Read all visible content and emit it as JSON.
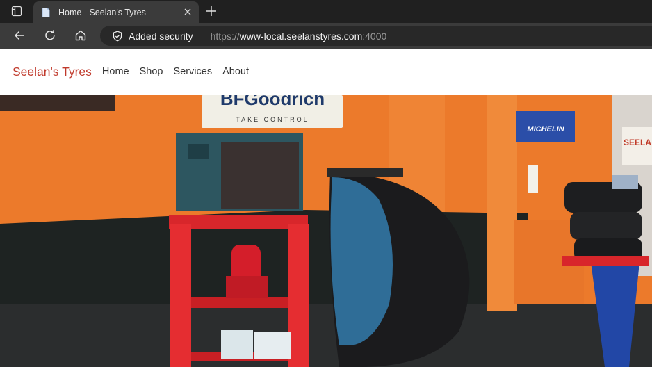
{
  "browser": {
    "tab": {
      "title": "Home - Seelan's Tyres"
    },
    "address": {
      "security_label": "Added security",
      "url_scheme": "https://",
      "url_host": "www-local.seelanstyres.com",
      "url_port": ":4000"
    }
  },
  "site": {
    "brand": "Seelan's Tyres",
    "nav": [
      "Home",
      "Shop",
      "Services",
      "About"
    ]
  },
  "hero": {
    "signs": {
      "left": "BFGoodrich",
      "left_tag": "TAKE CONTROL",
      "right": "MICHELIN",
      "edge": "SEELA"
    }
  },
  "colors": {
    "brand": "#c0392b",
    "wall": "#f0802a",
    "chrome_dark": "#202020",
    "chrome_mid": "#3b3b3b"
  }
}
